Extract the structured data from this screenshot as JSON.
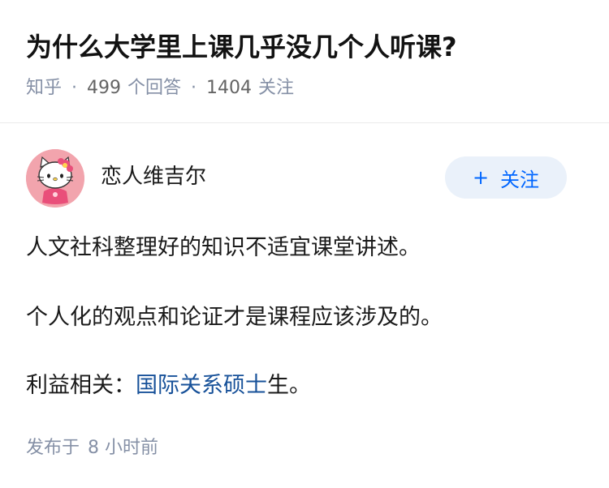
{
  "question": {
    "title": "为什么大学里上课几乎没几个人听课?",
    "source": "知乎",
    "separator": "·",
    "answer_count": "499",
    "answer_label": "个回答",
    "follow_count": "1404",
    "follow_label": "关注"
  },
  "author": {
    "name": "恋人维吉尔",
    "avatar_icon": "hello-kitty-avatar",
    "follow_button": {
      "icon": "+",
      "label": "关注"
    }
  },
  "answer": {
    "line1": "人文社科整理好的知识不适宜课堂讲述。",
    "line2": "个人化的观点和论证才是课程应该涉及的。",
    "line3_prefix": "利益相关：",
    "line3_link": "国际关系硕士",
    "line3_suffix": "生。"
  },
  "publish": {
    "label": "发布于",
    "amount": "8",
    "unit": "小时前"
  },
  "colors": {
    "link": "#175199",
    "follow_text": "#0066ff",
    "follow_bg": "#eaf1fa",
    "meta_text": "#8590a6",
    "avatar_bg": "#f2a4ad"
  }
}
